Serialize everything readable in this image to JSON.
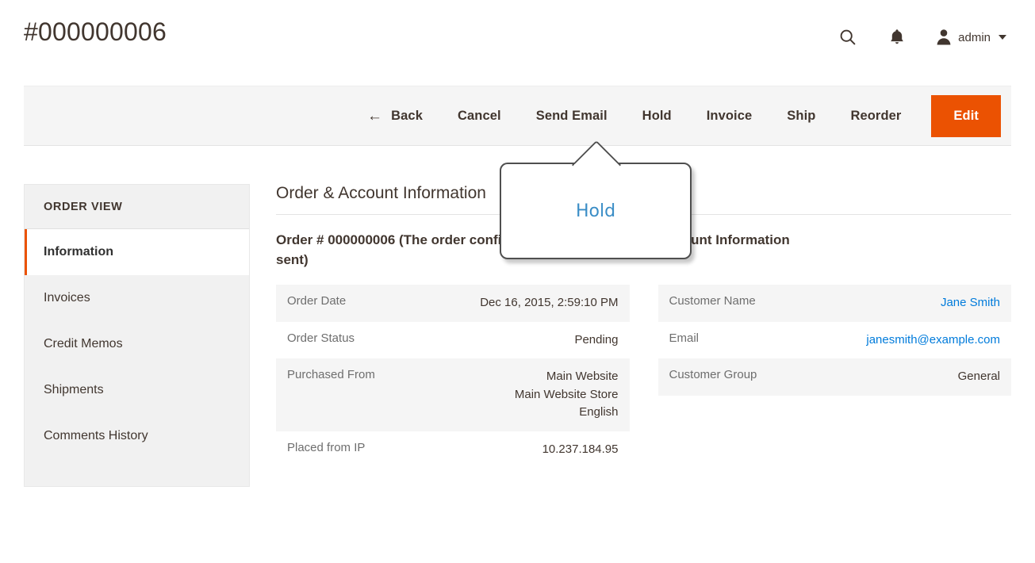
{
  "header": {
    "title": "#000000006",
    "icons": [
      {
        "name": "search-icon",
        "label": "Search"
      },
      {
        "name": "notifications-bell-icon",
        "label": "Notifications"
      }
    ],
    "user": {
      "name": "admin",
      "avatar_icon": "user-avatar-icon",
      "caret_icon": "chevron-down-icon"
    }
  },
  "toolbar": {
    "back_label": "Back",
    "back_icon": "arrow-left-icon",
    "cancel_label": "Cancel",
    "send_email_label": "Send Email",
    "hold_label": "Hold",
    "invoice_label": "Invoice",
    "ship_label": "Ship",
    "reorder_label": "Reorder",
    "edit_label": "Edit",
    "edit_color": "#eb5202"
  },
  "tooltip": {
    "text": "Hold",
    "text_color": "#3a8dc6",
    "border_color": "#4f4f4f",
    "anchor": "hold-button"
  },
  "sidebar": {
    "title": "ORDER VIEW",
    "active_color": "#eb5202",
    "items": [
      {
        "label": "Information",
        "active": true
      },
      {
        "label": "Invoices",
        "active": false
      },
      {
        "label": "Credit Memos",
        "active": false
      },
      {
        "label": "Shipments",
        "active": false
      },
      {
        "label": "Comments History",
        "active": false
      }
    ]
  },
  "main": {
    "section_heading_left": "Order & Account Information",
    "section_heading_right": "",
    "order": {
      "block_title": "Order # 000000006 (The order confirmation email was sent)",
      "rows": [
        {
          "label": "Order Date",
          "value": "Dec 16, 2015, 2:59:10 PM",
          "striped": true,
          "multiline": false
        },
        {
          "label": "Order Status",
          "value": "Pending",
          "striped": false,
          "multiline": false
        },
        {
          "label": "Purchased From",
          "value": [
            "Main Website",
            "Main Website Store",
            "English"
          ],
          "striped": true,
          "multiline": true
        },
        {
          "label": "Placed from IP",
          "value": "10.237.184.95",
          "striped": false,
          "multiline": false
        }
      ]
    },
    "account": {
      "block_title": "Account Information",
      "link_color": "#007bdb",
      "rows": [
        {
          "label": "Customer Name",
          "value": "Jane Smith",
          "striped": true,
          "is_link": true
        },
        {
          "label": "Email",
          "value": "janesmith@example.com",
          "striped": false,
          "is_link": true
        },
        {
          "label": "Customer Group",
          "value": "General",
          "striped": true,
          "is_link": false
        }
      ]
    }
  }
}
